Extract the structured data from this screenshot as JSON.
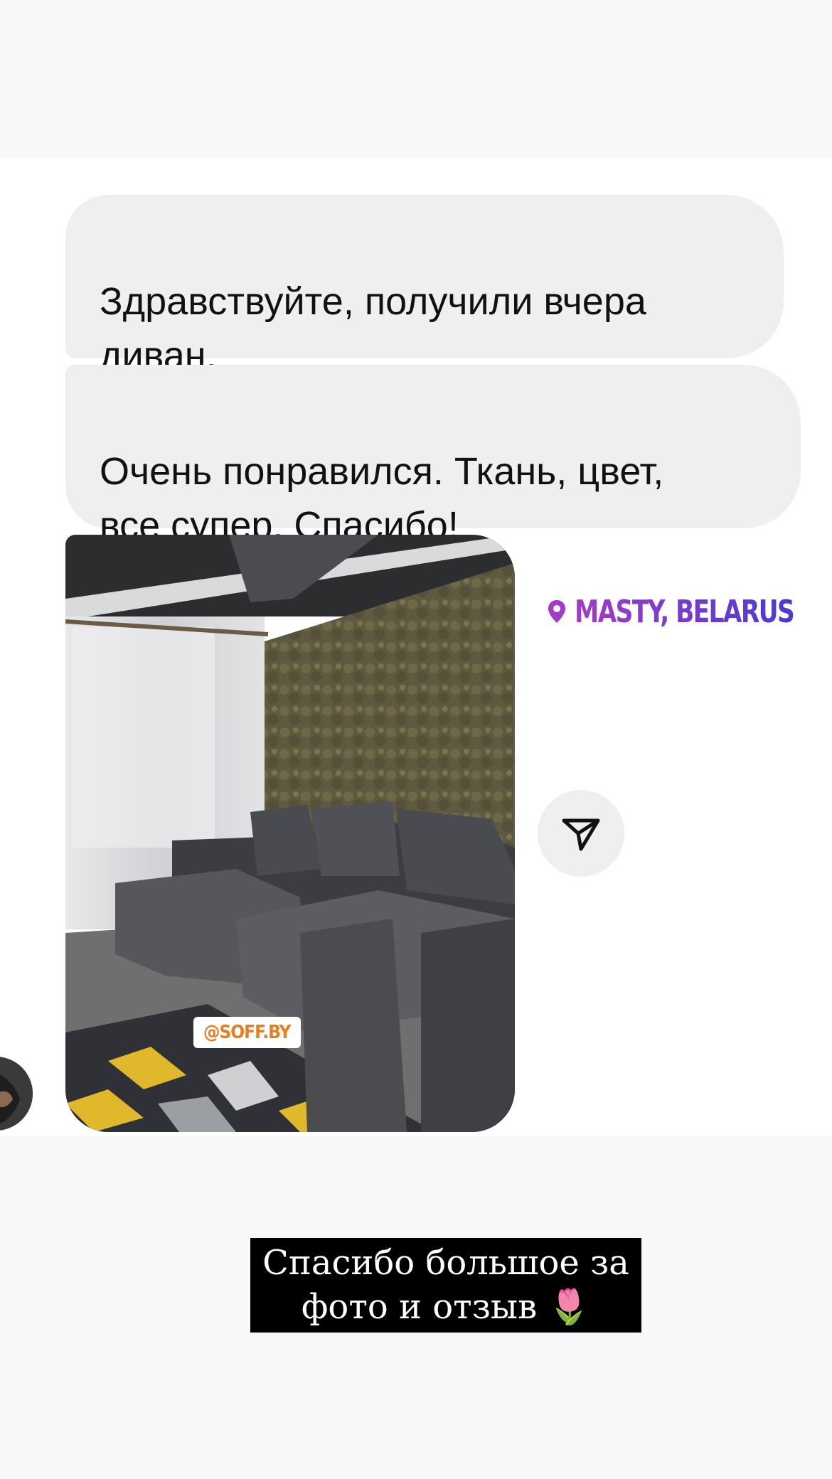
{
  "messages": [
    {
      "text": "Здравствуйте, получили вчера\nдиван."
    },
    {
      "text": "Очень понравился. Ткань, цвет,\nвсе супер. Спасибо!"
    }
  ],
  "photo": {
    "sticker": "@SOFF.BY"
  },
  "location": {
    "icon": "location-pin-icon",
    "label": "MASTY, BELARUS"
  },
  "share_button": {
    "icon": "send-icon"
  },
  "caption": {
    "line1": "Спасибо большое за",
    "line2": "фото и отзыв 🌷"
  },
  "colors": {
    "bubble": "#efefef",
    "background": "#f8f8fa",
    "location_gradient_start": "#a23cc8",
    "location_gradient_end": "#4a3ad6",
    "caption_bg": "#000000"
  }
}
